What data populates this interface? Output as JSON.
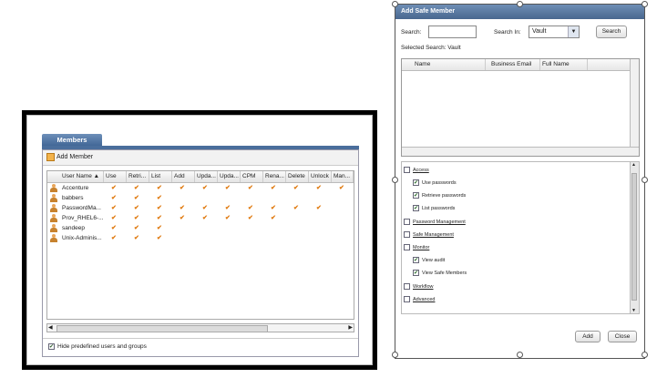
{
  "members_panel": {
    "tab_label": "Members",
    "add_member_label": "Add Member",
    "columns": [
      "User Name ▲",
      "Use",
      "Retri...",
      "List",
      "Add",
      "Upda...",
      "Upda...",
      "CPM",
      "Rena...",
      "Delete",
      "Unlock",
      "Man..."
    ],
    "rows": [
      {
        "name": "Accenture",
        "checks": [
          true,
          true,
          true,
          true,
          true,
          true,
          true,
          true,
          true,
          true,
          true
        ]
      },
      {
        "name": "babbers",
        "checks": [
          true,
          true,
          true,
          false,
          false,
          false,
          false,
          false,
          false,
          false,
          false
        ]
      },
      {
        "name": "PasswordMa...",
        "checks": [
          true,
          true,
          true,
          true,
          true,
          true,
          true,
          true,
          true,
          true,
          false
        ]
      },
      {
        "name": "Prov_RHEL6-...",
        "checks": [
          true,
          true,
          true,
          true,
          true,
          true,
          true,
          true,
          false,
          false,
          false
        ]
      },
      {
        "name": "sandeep",
        "checks": [
          true,
          true,
          true,
          false,
          false,
          false,
          false,
          false,
          false,
          false,
          false
        ]
      },
      {
        "name": "Unix-Adminis...",
        "checks": [
          true,
          true,
          true,
          false,
          false,
          false,
          false,
          false,
          false,
          false,
          false
        ]
      }
    ],
    "check_glyph": "✔",
    "hide_predefined_label": "Hide predefined users and groups"
  },
  "add_safe_member": {
    "title": "Add Safe Member",
    "search_label": "Search:",
    "search_value": "",
    "search_in_label": "Search In:",
    "search_in_value": "Vault",
    "search_button": "Search",
    "selected_search": "Selected Search: Vault",
    "result_columns": [
      "Name",
      "Business Email",
      "Full Name"
    ],
    "permissions": [
      {
        "label": "Access",
        "level": 0,
        "checked": false
      },
      {
        "label": "Use passwords",
        "level": 1,
        "checked": true
      },
      {
        "label": "Retrieve passwords",
        "level": 1,
        "checked": true
      },
      {
        "label": "List passwords",
        "level": 1,
        "checked": true
      },
      {
        "label": "Password Management",
        "level": 0,
        "checked": false
      },
      {
        "label": "Safe Management",
        "level": 0,
        "checked": false
      },
      {
        "label": "Monitor",
        "level": 0,
        "checked": false
      },
      {
        "label": "View audit",
        "level": 1,
        "checked": true
      },
      {
        "label": "View Safe Members",
        "level": 1,
        "checked": true
      },
      {
        "label": "Workflow",
        "level": 0,
        "checked": false
      },
      {
        "label": "Advanced",
        "level": 0,
        "checked": false
      }
    ],
    "add_button": "Add",
    "close_button": "Close"
  }
}
